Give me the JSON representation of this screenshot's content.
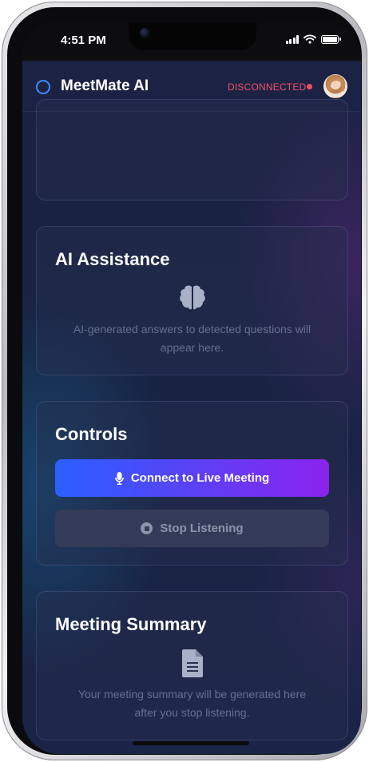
{
  "status_bar": {
    "time": "4:51 PM"
  },
  "header": {
    "app_title": "MeetMate AI",
    "connection_status": "DISCONNECTED",
    "status_color": "#f05265",
    "accent_color": "#3b8bff"
  },
  "cards": {
    "ai_assistance": {
      "title": "AI Assistance",
      "icon": "brain-icon",
      "placeholder_line1": "AI-generated answers to detected questions will",
      "placeholder_line2": "appear here."
    },
    "controls": {
      "title": "Controls",
      "connect_button": "Connect to Live Meeting",
      "connect_icon": "microphone-icon",
      "stop_button": "Stop Listening",
      "stop_icon": "stop-circle-icon"
    },
    "meeting_summary": {
      "title": "Meeting Summary",
      "icon": "document-icon",
      "placeholder_line1": "Your meeting summary will be generated here",
      "placeholder_line2": "after you stop listening."
    }
  }
}
